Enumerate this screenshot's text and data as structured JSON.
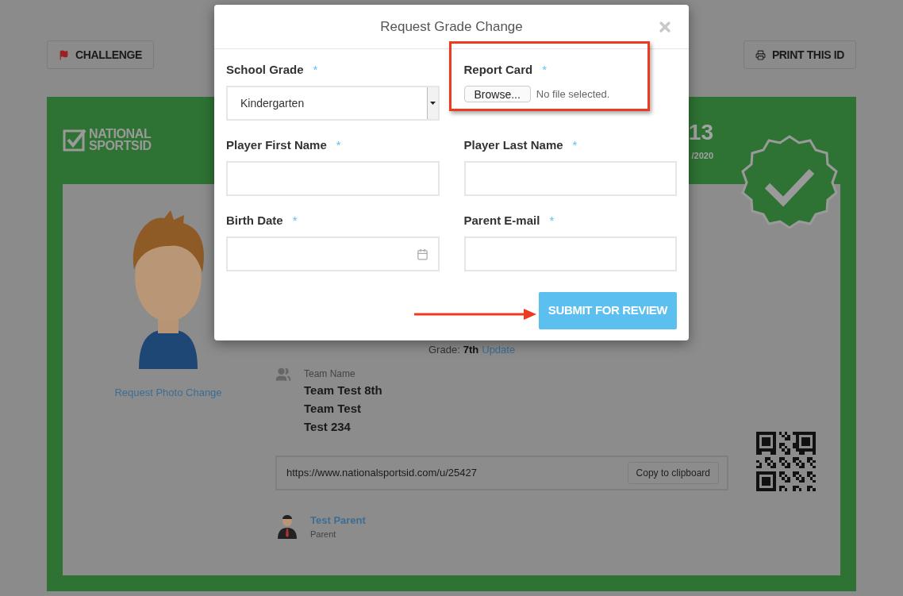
{
  "page": {
    "buttons": [
      {
        "kind": "flag",
        "label": "CHALLENGE"
      },
      {
        "kind": "print",
        "label": "PRINT THIS ID"
      }
    ],
    "card": {
      "logo": [
        "NATIONAL",
        "SPORTSID"
      ],
      "id_number": "13",
      "date": "/2020",
      "photo_link": "Request Photo Change",
      "grade_label": "Grade:",
      "grade": "7th",
      "grade_link": "Update",
      "team_label": "Team Name",
      "teams": [
        "Team Test 8th",
        "Team Test",
        "Test 234"
      ],
      "profile_url": "https://www.nationalsportsid.com/u/25427",
      "copy_button": "Copy to clipboard",
      "parent_name": "Test Parent",
      "parent_role": "Parent"
    }
  },
  "dialog": {
    "title": "Request Grade Change",
    "fields": [
      {
        "kind": "select",
        "label": "School Grade",
        "mark": "*",
        "value": "Kindergarten",
        "highlighted": false
      },
      {
        "kind": "file",
        "label": "Report Card",
        "mark": "*",
        "button": "Browse...",
        "status": "No file selected.",
        "highlighted": true
      },
      {
        "kind": "text",
        "label": "Player First Name",
        "mark": "*",
        "highlighted": false
      },
      {
        "kind": "text",
        "label": "Player Last Name",
        "mark": "*",
        "highlighted": false
      },
      {
        "kind": "date",
        "label": "Birth Date",
        "mark": "*",
        "highlighted": false
      },
      {
        "kind": "text",
        "label": "Parent E-mail",
        "mark": "*",
        "highlighted": false
      }
    ],
    "submit": "SUBMIT FOR REVIEW"
  }
}
